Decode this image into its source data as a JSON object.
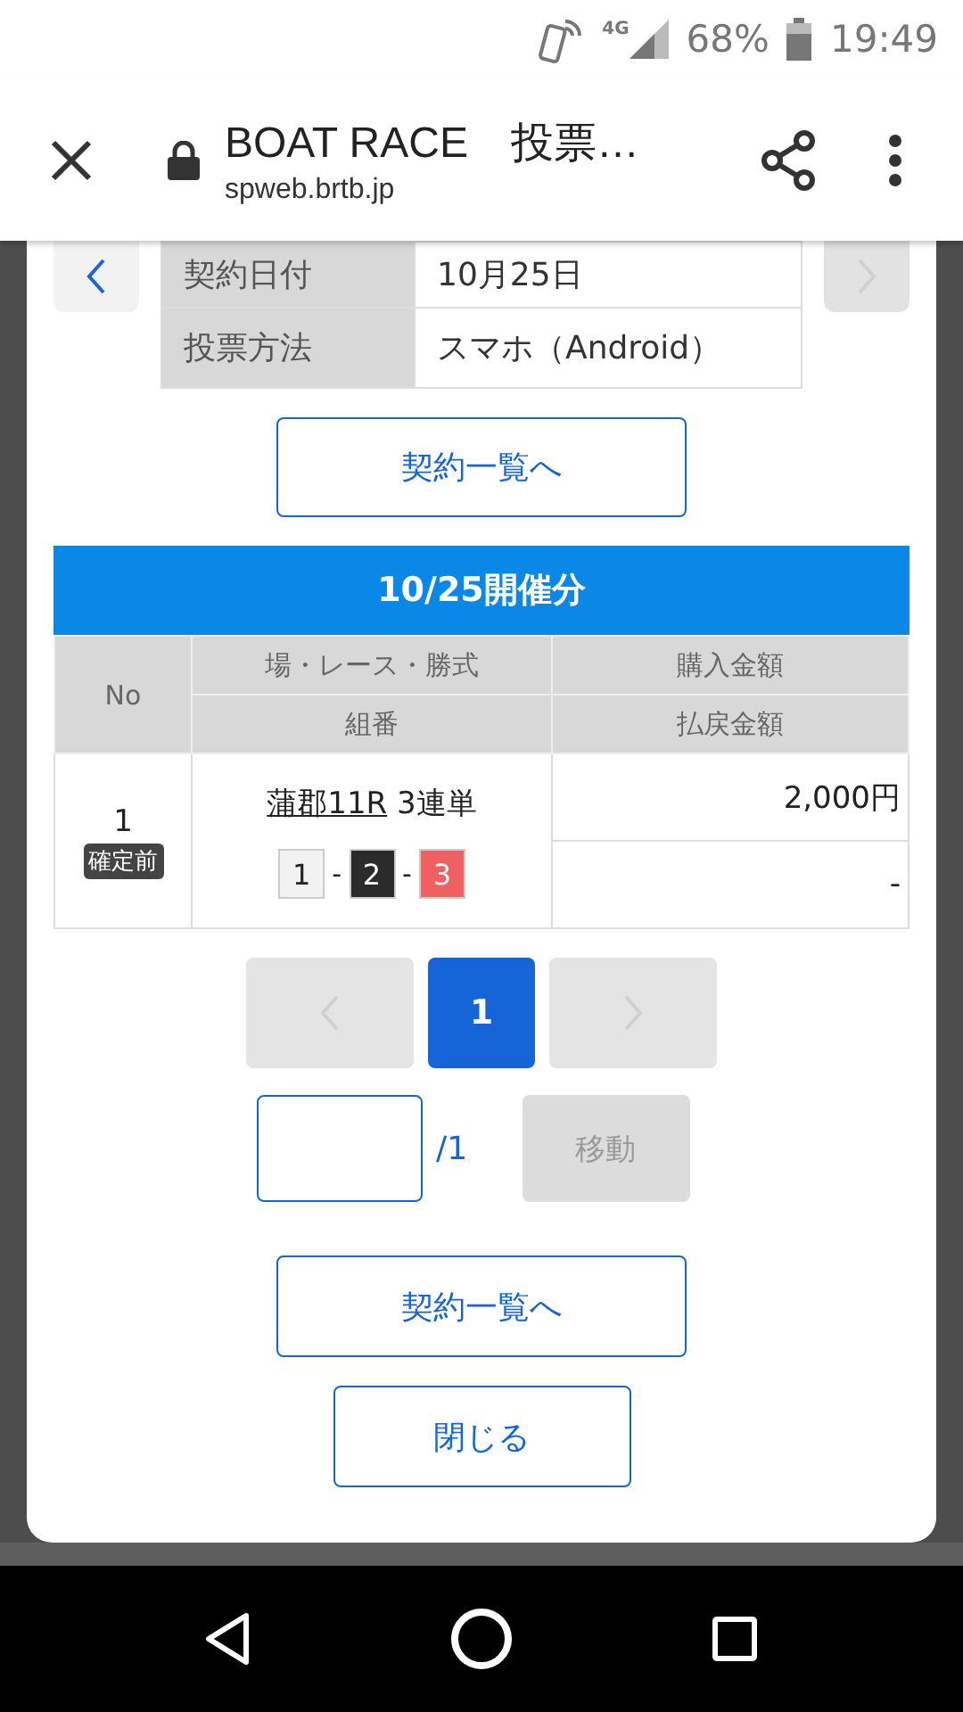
{
  "status_bar": {
    "network": "4G",
    "battery": "68%",
    "time": "19:49"
  },
  "browser": {
    "title": "BOAT RACE　投票…",
    "url": "spweb.brtb.jp"
  },
  "contract_nav": {
    "prev_disabled": false,
    "next_disabled": true
  },
  "info_rows": [
    {
      "label": "契約日付",
      "value": "10月25日"
    },
    {
      "label": "投票方法",
      "value": "スマホ（Android）"
    }
  ],
  "top_button": "契約一覧へ",
  "section_title": "10/25開催分",
  "table": {
    "columns": {
      "no": "No",
      "race": "場・レース・勝式",
      "combo": "組番",
      "amount": "購入金額",
      "payout": "払戻金額"
    },
    "rows": [
      {
        "no": "1",
        "status": "確定前",
        "venue_race": "蒲郡11R",
        "bet_type": "3連単",
        "combo": [
          {
            "number": "1",
            "color": "#f2f2f2"
          },
          {
            "separator": "-",
            "number": "2",
            "color": "#2b2b2b"
          },
          {
            "separator": "-",
            "number": "3",
            "color": "#ef6060"
          }
        ],
        "amount": "2,000円",
        "payout": "-"
      }
    ]
  },
  "pagination": {
    "prev_disabled": true,
    "next_disabled": true,
    "pages": [
      {
        "label": "1",
        "selected": true
      }
    ]
  },
  "page_jump": {
    "total": "/1",
    "button": "移動",
    "button_disabled": true
  },
  "bottom_buttons": [
    "契約一覧へ",
    "閉じる"
  ]
}
